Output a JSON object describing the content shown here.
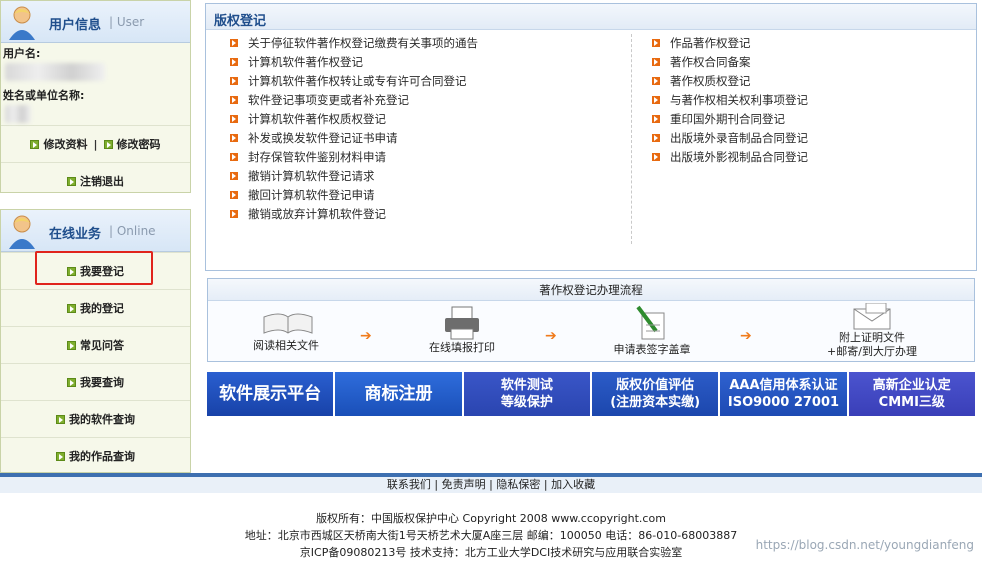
{
  "user_panel": {
    "title": "用户信息",
    "subtitle": "User",
    "username_label": "用户名:",
    "orgname_label": "姓名或单位名称:",
    "edit_profile": "修改资料",
    "separator": "|",
    "change_password": "修改密码",
    "logout": "注销退出"
  },
  "online_panel": {
    "title": "在线业务",
    "subtitle": "Online",
    "items": [
      "我要登记",
      "我的登记",
      "常见问答",
      "我要查询",
      "我的软件查询",
      "我的作品查询"
    ]
  },
  "main": {
    "title": "版权登记",
    "left_links": [
      "关于停征软件著作权登记缴费有关事项的通告",
      "计算机软件著作权登记",
      "计算机软件著作权转让或专有许可合同登记",
      "软件登记事项变更或者补充登记",
      "计算机软件著作权质权登记",
      "补发或换发软件登记证书申请",
      "封存保管软件鉴别材料申请",
      "撤销计算机软件登记请求",
      "撤回计算机软件登记申请",
      "撤销或放弃计算机软件登记"
    ],
    "right_links": [
      "作品著作权登记",
      "著作权合同备案",
      "著作权质权登记",
      "与著作权相关权利事项登记",
      "重印国外期刊合同登记",
      "出版境外录音制品合同登记",
      "出版境外影视制品合同登记"
    ]
  },
  "flow": {
    "title": "著作权登记办理流程",
    "steps": [
      "阅读相关文件",
      "在线填报打印",
      "申请表签字盖章",
      "附上证明文件",
      "+邮寄/到大厅办理"
    ],
    "arrow": "➔"
  },
  "banners": {
    "b1": "软件展示平台",
    "b2": "商标注册",
    "b3_l1": "软件测试",
    "b3_l2": "等级保护",
    "b4_l1": "版权价值评估",
    "b4_l2": "(注册资本实缴)",
    "b5_l1": "AAA信用体系认证",
    "b5_l2": "ISO9000 27001",
    "b6_l1": "高新企业认定",
    "b6_l2": "CMMI三级"
  },
  "bottom_links": [
    "联系我们",
    "免责声明",
    "隐私保密",
    "加入收藏"
  ],
  "bottom_sep": "|",
  "footer": {
    "line1": "版权所有：中国版权保护中心 Copyright 2008 www.ccopyright.com",
    "line2": "地址：北京市西城区天桥南大街1号天桥艺术大厦A座三层 邮编：100050 电话：86-010-68003887",
    "line3": "京ICP备09080213号 技术支持：北方工业大学DCI技术研究与应用联合实验室"
  },
  "watermark": "https://blog.csdn.net/youngdianfeng"
}
